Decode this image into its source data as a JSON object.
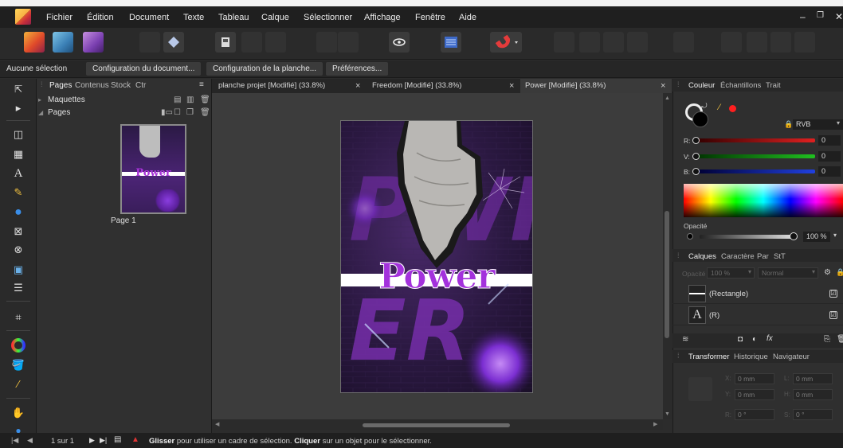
{
  "menu": {
    "items": [
      "Fichier",
      "Édition",
      "Document",
      "Texte",
      "Tableau",
      "Calque",
      "Sélectionner",
      "Affichage",
      "Fenêtre",
      "Aide"
    ],
    "window_controls": [
      "–",
      "❐",
      "✕"
    ]
  },
  "context_bar": {
    "selection_label": "Aucune sélection",
    "buttons": [
      "Configuration du document...",
      "Configuration de la planche...",
      "Préférences..."
    ]
  },
  "pages_panel": {
    "tabs": [
      "Pages",
      "Contenus",
      "Stock",
      "Ctr"
    ],
    "sections": [
      "Maquettes",
      "Pages"
    ],
    "page_label": "Page 1",
    "thumb_text": "Power"
  },
  "doc_tabs": [
    {
      "label": "planche  projet [Modifié] (33.8%)",
      "active": false
    },
    {
      "label": "Freedom [Modifié] (33.8%)",
      "active": false
    },
    {
      "label": "Power [Modifié] (33.8%)",
      "active": true
    }
  ],
  "artboard": {
    "title": "Power",
    "bg_letters": "PWR",
    "accent": "#9b2dd6"
  },
  "color_panel": {
    "tabs": [
      "Couleur",
      "Échantillons",
      "Trait"
    ],
    "model": "RVB",
    "channels": [
      {
        "label": "R:",
        "value": "0",
        "color": "#e02020"
      },
      {
        "label": "V:",
        "value": "0",
        "color": "#20c020"
      },
      {
        "label": "B:",
        "value": "0",
        "color": "#2040e0"
      }
    ],
    "opacity_label": "Opacité",
    "opacity_value": "100 %"
  },
  "layers_panel": {
    "tabs": [
      "Calques",
      "Caractère",
      "Par",
      "StT"
    ],
    "opacity_label": "Opacité",
    "opacity_value": "100 %",
    "blend_mode": "Normal",
    "layers": [
      {
        "name": "(Rectangle)",
        "checked": "☑"
      },
      {
        "name": "(R)",
        "checked": "☑"
      }
    ]
  },
  "transform_panel": {
    "tabs": [
      "Transformer",
      "Historique",
      "Navigateur"
    ],
    "fields": [
      {
        "label": "X:",
        "value": "0 mm"
      },
      {
        "label": "L:",
        "value": "0 mm"
      },
      {
        "label": "Y:",
        "value": "0 mm"
      },
      {
        "label": "H:",
        "value": "0 mm"
      },
      {
        "label": "R:",
        "value": "0 °"
      },
      {
        "label": "S:",
        "value": "0 °"
      }
    ]
  },
  "status_bar": {
    "page_nav": "1 sur 1",
    "drag_bold": "Glisser",
    "drag_text": " pour utiliser un cadre de sélection. ",
    "click_bold": "Cliquer",
    "click_text": " sur un objet pour le sélectionner."
  }
}
